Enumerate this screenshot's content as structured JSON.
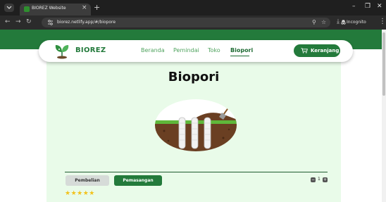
{
  "browser": {
    "tab_title": "BIOREZ Website",
    "tab_close": "×",
    "new_tab": "+",
    "url": "biorez.netlify.app/#/biopore",
    "mode_label": "Incognito",
    "window_minimize": "–",
    "window_maximize": "❐",
    "window_close": "✕",
    "nav_back": "←",
    "nav_forward": "→",
    "nav_reload": "↻",
    "search_icon": "⚲",
    "star_icon": "☆",
    "download_icon": "⤓",
    "menu_dots": "⋮"
  },
  "site": {
    "brand": "BIOREZ",
    "nav": [
      {
        "label": "Beranda"
      },
      {
        "label": "Pemindai"
      },
      {
        "label": "Toko"
      },
      {
        "label": "Biopori",
        "active": true
      }
    ],
    "cart_label": "Keranjang"
  },
  "main": {
    "title": "Biopori",
    "tabs": {
      "pembelian": "Pembelian",
      "pemasangan": "Pemasangan",
      "selected": "Pemasangan"
    },
    "quantity": {
      "minus": "−",
      "value": "1",
      "plus": "+"
    },
    "rating": "★★★★★"
  },
  "colors": {
    "brand_green": "#237a3b",
    "content_bg": "#e9fbe9",
    "star": "#f2c21b"
  }
}
